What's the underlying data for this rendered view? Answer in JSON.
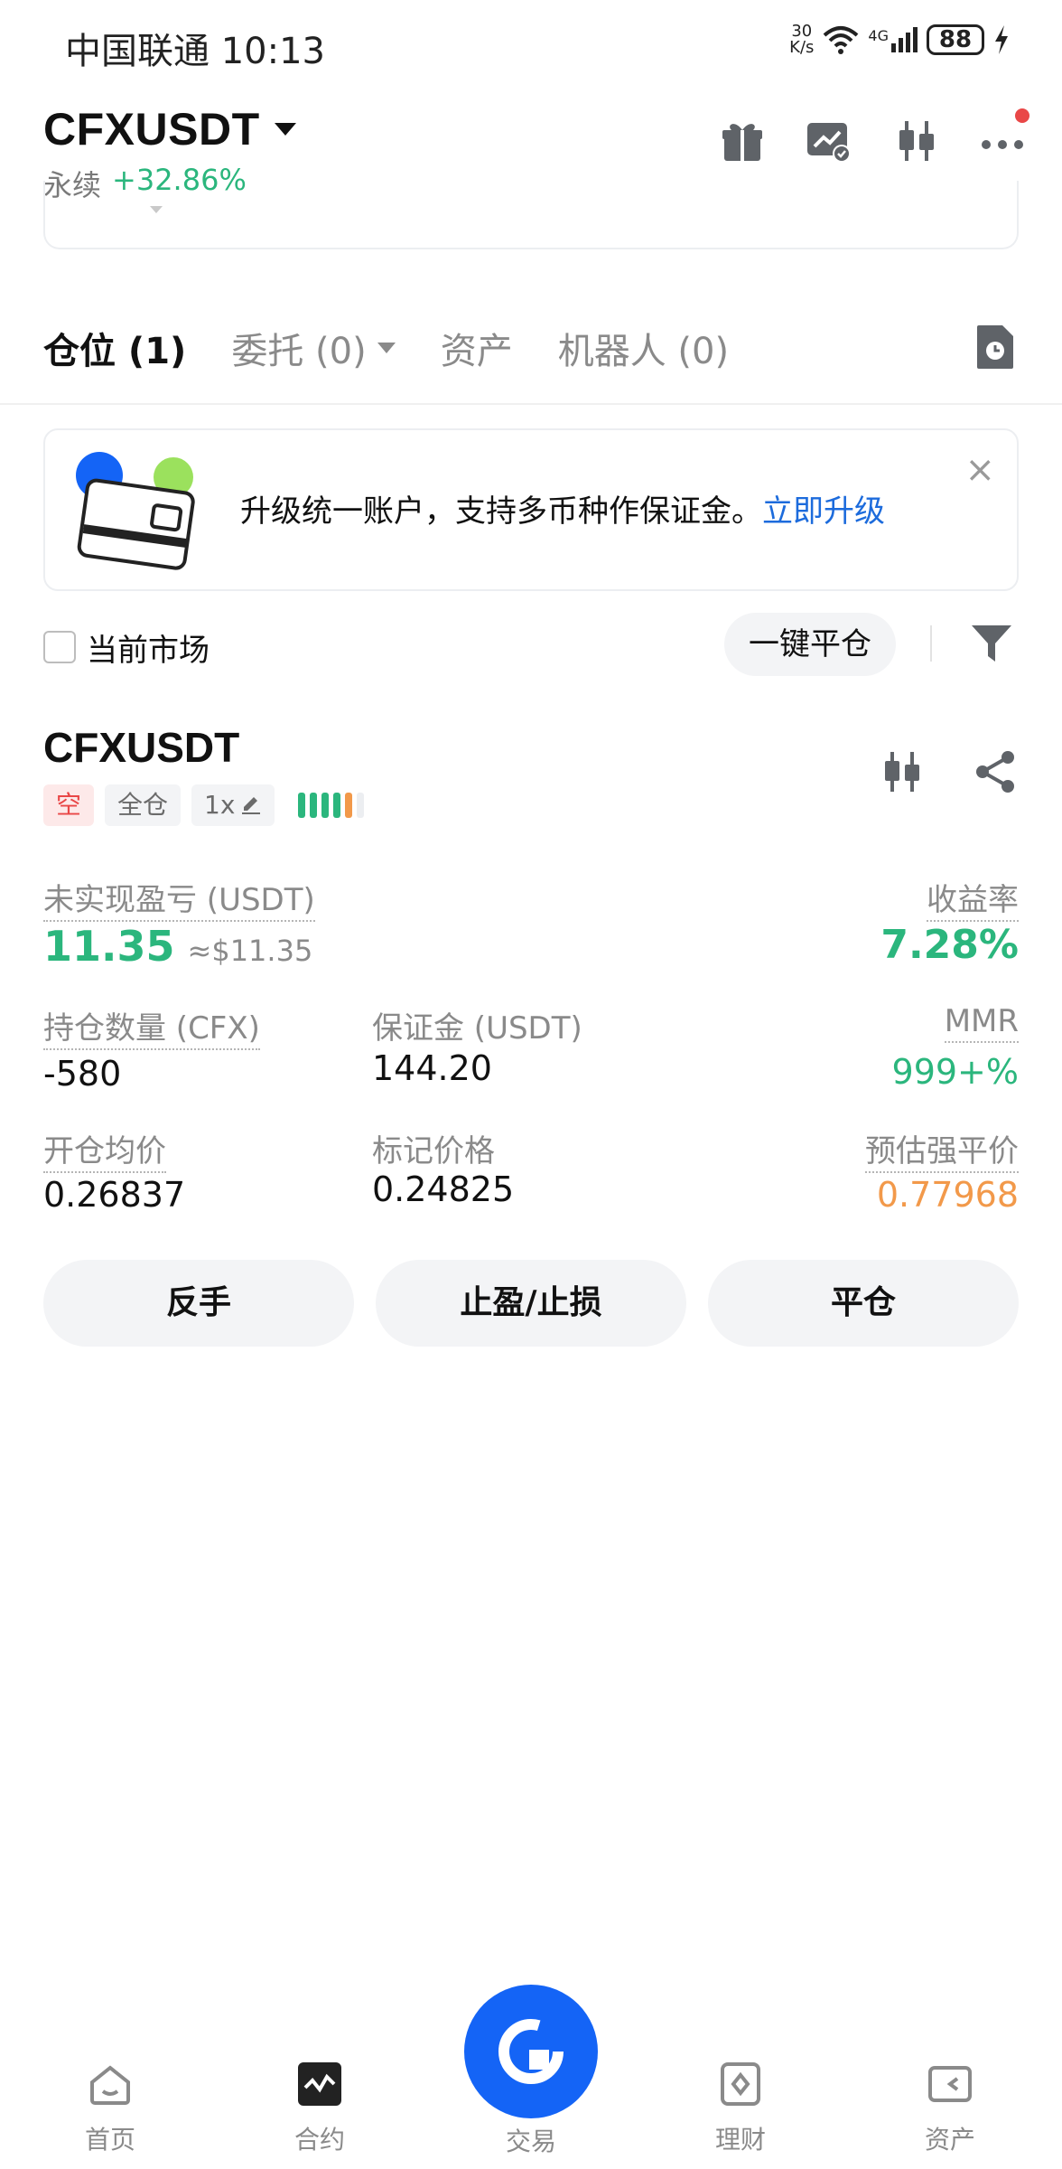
{
  "status_bar": {
    "carrier_time": "中国联通 10:13",
    "net_speed_value": "30",
    "net_speed_unit": "K/s",
    "network": "4G",
    "battery": "88"
  },
  "header": {
    "pair": "CFXUSDT",
    "contract_type": "永续",
    "change": "+32.86%",
    "icons": [
      "gift-icon",
      "chart-check-icon",
      "candlestick-icon",
      "more-icon"
    ]
  },
  "tabs": [
    {
      "label": "仓位 (1)"
    },
    {
      "label": "委托 (0)"
    },
    {
      "label": "资产"
    },
    {
      "label": "机器人 (0)"
    }
  ],
  "banner": {
    "text": "升级统一账户，支持多币种作保证金。",
    "link": "立即升级",
    "close": "×"
  },
  "filter": {
    "current_market_label": "当前市场",
    "close_all_label": "一键平仓"
  },
  "position": {
    "symbol": "CFXUSDT",
    "side": "空",
    "margin_mode": "全仓",
    "leverage": "1x",
    "unrealized_pnl_label": "未实现盈亏 (USDT)",
    "unrealized_pnl": "11.35",
    "unrealized_pnl_usd": "≈$11.35",
    "roe_label": "收益率",
    "roe": "7.28%",
    "qty_label": "持仓数量 (CFX)",
    "qty": "-580",
    "margin_label": "保证金 (USDT)",
    "margin": "144.20",
    "mmr_label": "MMR",
    "mmr": "999+%",
    "entry_label": "开仓均价",
    "entry": "0.26837",
    "mark_label": "标记价格",
    "mark": "0.24825",
    "liq_label": "预估强平价",
    "liq": "0.77968",
    "actions": {
      "reverse": "反手",
      "tpsl": "止盈/止损",
      "close": "平仓"
    }
  },
  "bottom_nav": [
    {
      "label": "首页"
    },
    {
      "label": "合约"
    },
    {
      "label": "交易"
    },
    {
      "label": "理财"
    },
    {
      "label": "资产"
    }
  ],
  "colors": {
    "green": "#2bb67d",
    "red": "#e94747",
    "orange": "#f2994a",
    "link_blue": "#1c6bdc",
    "fab_blue": "#1464f6"
  }
}
